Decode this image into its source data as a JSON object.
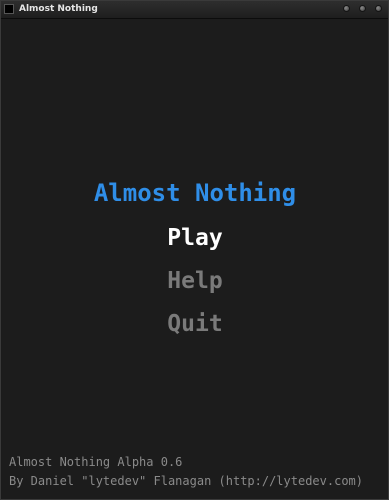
{
  "window": {
    "title": "Almost Nothing"
  },
  "menu": {
    "title": "Almost Nothing",
    "items": [
      {
        "label": "Play",
        "selected": true
      },
      {
        "label": "Help",
        "selected": false
      },
      {
        "label": "Quit",
        "selected": false
      }
    ]
  },
  "footer": {
    "version": "Almost Nothing Alpha 0.6",
    "credit": "By Daniel \"lytedev\" Flanagan (http://lytedev.com)"
  },
  "colors": {
    "background": "#1c1c1c",
    "title": "#2f8ee8",
    "selected": "#ffffff",
    "unselected": "#7a7a7a",
    "footer": "#8a8a8a"
  }
}
